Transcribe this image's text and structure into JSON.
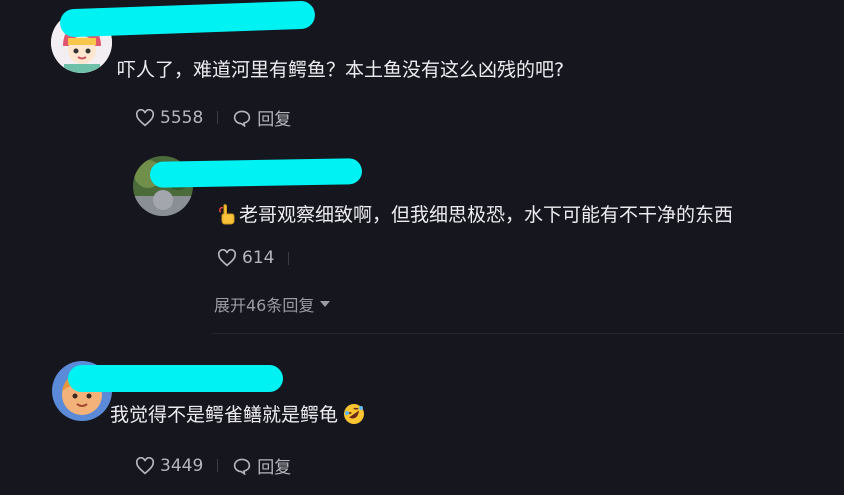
{
  "comments": [
    {
      "text": "吓人了，难道河里有鳄鱼？本土鱼没有这么凶残的吧?",
      "likes": "5558",
      "reply_label": "回复",
      "replies": [
        {
          "text": "老哥观察细致啊，但我细思极恐，水下可能有不干净的东西",
          "likes": "614",
          "emoji": "pinky-promise-emoji"
        }
      ],
      "expand_label": "展开46条回复"
    },
    {
      "text": "我觉得不是鳄雀鳝就是鳄龟",
      "likes": "3449",
      "reply_label": "回复",
      "emoji": "rolling-laughing-emoji"
    }
  ],
  "icons": {
    "like": "heart-outline-icon",
    "reply": "speech-bubble-icon",
    "expand": "caret-down-icon"
  },
  "colors": {
    "background": "#16161e",
    "text": "#ececf0",
    "secondary_text": "#b5b5bc",
    "redaction": "#00f2f2"
  }
}
